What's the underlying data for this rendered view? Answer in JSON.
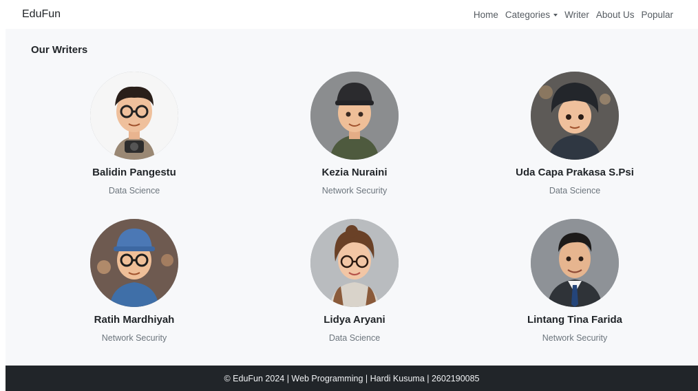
{
  "navbar": {
    "brand": "EduFun",
    "links": [
      "Home",
      "Categories",
      "Writer",
      "About Us",
      "Popular"
    ]
  },
  "page": {
    "title": "Our Writers"
  },
  "writers": [
    {
      "name": "Balidin Pangestu",
      "category": "Data Science"
    },
    {
      "name": "Kezia Nuraini",
      "category": "Network Security"
    },
    {
      "name": "Uda Capa Prakasa S.Psi",
      "category": "Data Science"
    },
    {
      "name": "Ratih Mardhiyah",
      "category": "Network Security"
    },
    {
      "name": "Lidya Aryani",
      "category": "Data Science"
    },
    {
      "name": "Lintang Tina Farida",
      "category": "Network Security"
    }
  ],
  "footer": {
    "text": "© EduFun 2024 | Web Programming | Hardi Kusuma | 2602190085"
  }
}
